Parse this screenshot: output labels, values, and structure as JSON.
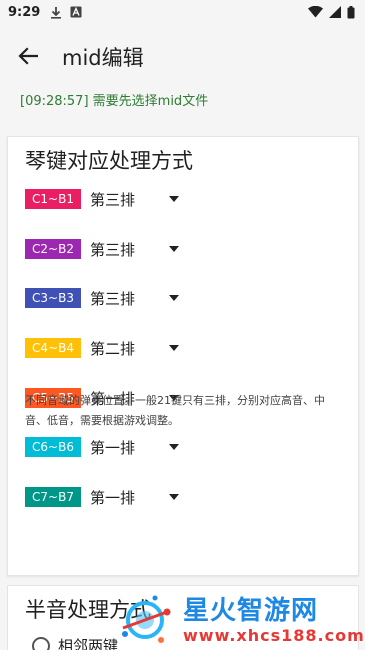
{
  "status_bar": {
    "time": "9:29",
    "icons": [
      "download-icon",
      "app-a-icon",
      "wifi-icon",
      "signal-icon",
      "battery-icon"
    ]
  },
  "app_bar": {
    "title": "mid编辑"
  },
  "log": {
    "message": "[09:28:57] 需要先选择mid文件"
  },
  "key_mapping": {
    "title": "琴键对应处理方式",
    "rows": [
      {
        "range": "C1~B1",
        "value": "第三排",
        "color": "#e91e63"
      },
      {
        "range": "C2~B2",
        "value": "第三排",
        "color": "#9c27b0"
      },
      {
        "range": "C3~B3",
        "value": "第三排",
        "color": "#3f51b5"
      },
      {
        "range": "C4~B4",
        "value": "第二排",
        "color": "#ffc107"
      },
      {
        "range": "C5~B5",
        "value": "第一排",
        "color": "#ff5722"
      },
      {
        "range": "C6~B6",
        "value": "第一排",
        "color": "#00bcd4"
      },
      {
        "range": "C7~B7",
        "value": "第一排",
        "color": "#009688"
      }
    ],
    "note": "不同音域的弹奏位置。一般21键只有三排，分别对应高音、中音、低音，需要根据游戏调整。"
  },
  "semitone": {
    "title": "半音处理方式",
    "option_label": "相邻两键"
  },
  "watermark": {
    "name": "星火智游网",
    "url": "www.xhcs188.com"
  }
}
